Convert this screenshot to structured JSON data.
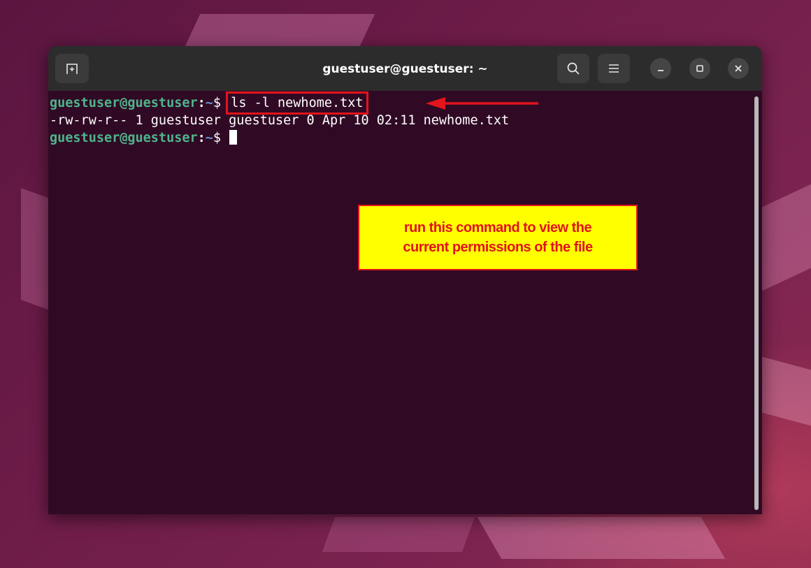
{
  "window": {
    "title": "guestuser@guestuser: ~"
  },
  "titlebar": {
    "new_tab_icon": "new-tab-icon",
    "search_icon": "search-icon",
    "menu_icon": "hamburger-menu-icon",
    "minimize_icon": "minimize-icon",
    "maximize_icon": "maximize-icon",
    "close_icon": "close-icon"
  },
  "terminal": {
    "lines": [
      {
        "user_host": "guestuser@guestuser",
        "sep": ":",
        "dir": "~",
        "dollar": "$ ",
        "command": "ls -l newhome.txt"
      },
      {
        "output": "-rw-rw-r-- 1 guestuser guestuser 0 Apr 10 02:11 newhome.txt"
      },
      {
        "user_host": "guestuser@guestuser",
        "sep": ":",
        "dir": "~",
        "dollar": "$ "
      }
    ]
  },
  "annotation": {
    "line1": "run this command to view the",
    "line2": "current permissions of the file",
    "color": "#e2141c",
    "background": "#ffff00"
  },
  "colors": {
    "terminal_bg": "#300a24",
    "prompt_user": "#4fb48c",
    "prompt_dir": "#6b8fd8",
    "titlebar": "#2c2c2c"
  }
}
